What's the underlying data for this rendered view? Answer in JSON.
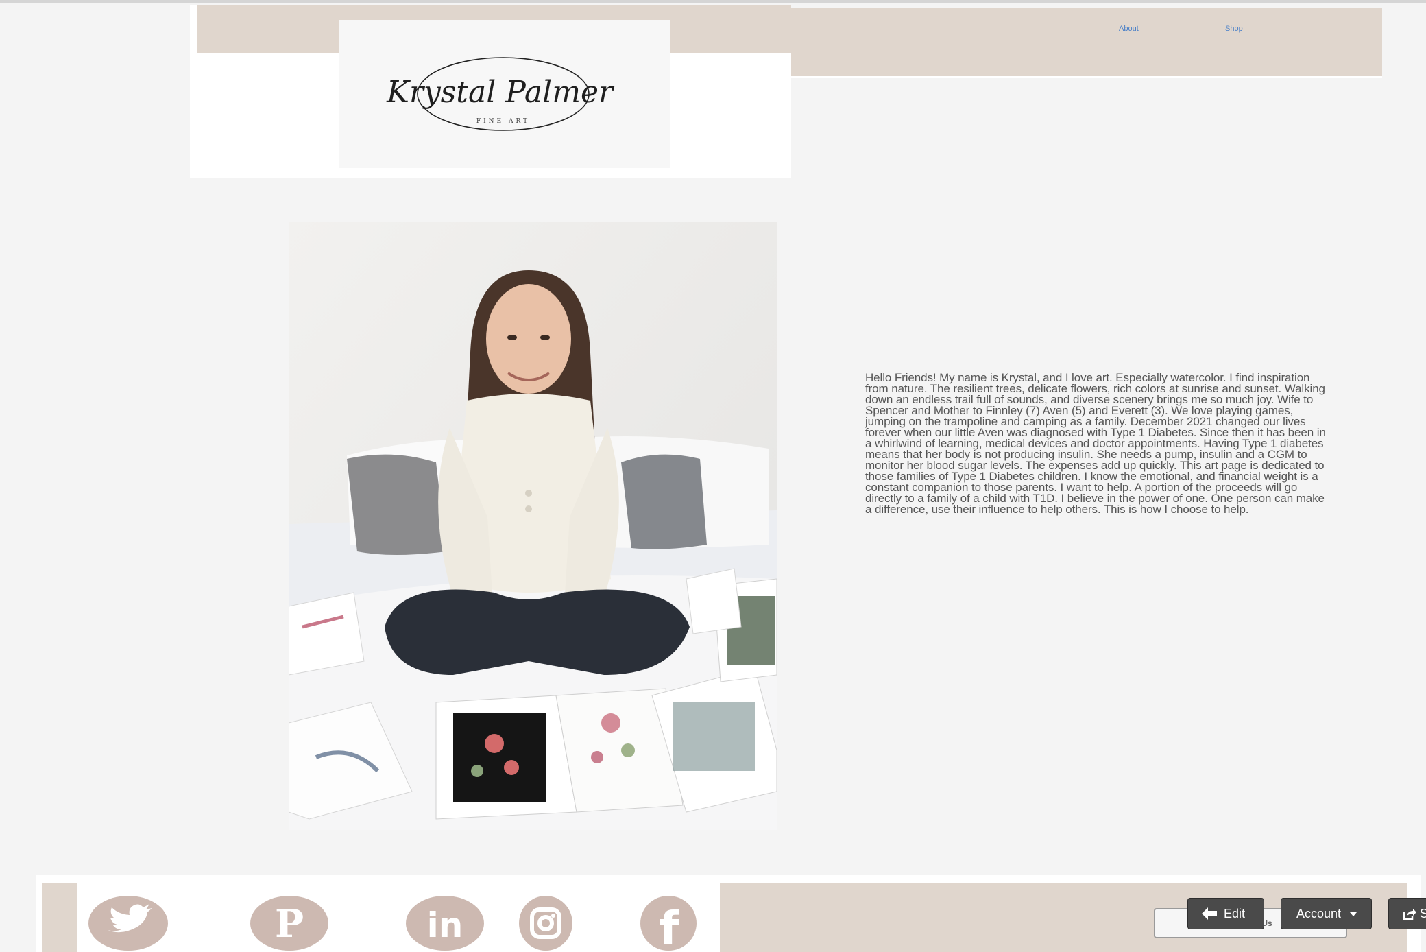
{
  "header": {
    "logo": {
      "name": "Krystal Palmer",
      "tagline": "FINE ART"
    },
    "nav": [
      {
        "label": "About"
      },
      {
        "label": "Shop"
      }
    ]
  },
  "photo": {
    "icon": "portrait-photo"
  },
  "bio": {
    "text": "Hello Friends! My name is Krystal, and I love art. Especially watercolor. I find inspiration from nature. The resilient trees, delicate flowers, rich colors at sunrise and sunset. Walking down an endless trail full of sounds, and diverse scenery brings me so much joy. Wife to Spencer and Mother to Finnley (7) Aven (5) and Everett (3). We love playing games, jumping on the trampoline and camping as a family. December 2021 changed our lives forever when our little Aven was diagnosed with Type 1 Diabetes. Since then it has been in a whirlwind of learning, medical devices and doctor appointments. Having Type 1 diabetes means that her body is not producing insulin. She needs a pump, insulin and a CGM to monitor her blood sugar levels. The expenses add up quickly. This art page is dedicated to those families of Type 1 Diabetes children. I know the emotional, and financial weight is a constant companion to those parents. I want to help. A portion of the proceeds will go directly to a family of a child with T1D. I believe in the power of one. One person can make a difference, use their influence to help others. This is how I choose to help."
  },
  "footer": {
    "social": [
      {
        "icon": "twitter-icon"
      },
      {
        "icon": "pinterest-icon"
      },
      {
        "icon": "linkedin-icon",
        "text": "in"
      },
      {
        "icon": "instagram-icon"
      },
      {
        "icon": "facebook-icon",
        "text": "f"
      }
    ],
    "contact_label": "Contact Us"
  },
  "admin": {
    "edit_label": "Edit",
    "account_label": "Account",
    "share_label": "S"
  },
  "colors": {
    "accent": "#e0d6cd",
    "icon": "#cdb9b1",
    "background": "#f4f4f4"
  }
}
